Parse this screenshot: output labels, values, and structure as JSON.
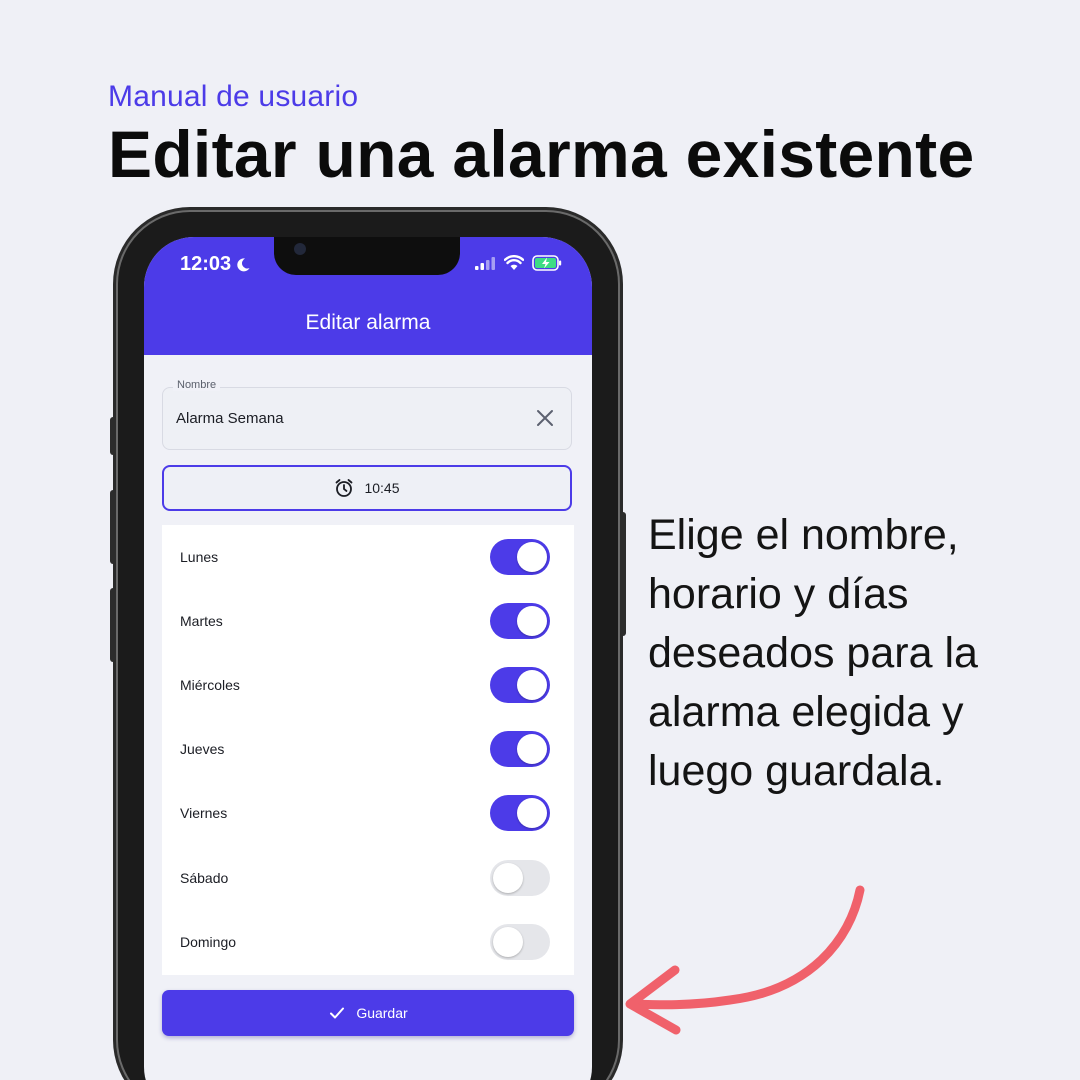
{
  "header": {
    "kicker": "Manual de usuario",
    "title": "Editar una alarma existente"
  },
  "caption": "Elige el nombre, horario y días deseados para la alarma elegida y luego guardala.",
  "phone": {
    "status_bar": {
      "time": "12:03",
      "icons": [
        "moon-icon",
        "signal-icon",
        "wifi-icon",
        "battery-charging-icon"
      ]
    },
    "appbar_title": "Editar alarma",
    "name_field": {
      "label": "Nombre",
      "value": "Alarma Semana",
      "clear_icon": "close-icon"
    },
    "time_button": {
      "icon": "alarm-clock-icon",
      "value": "10:45"
    },
    "days": [
      {
        "label": "Lunes",
        "enabled": true
      },
      {
        "label": "Martes",
        "enabled": true
      },
      {
        "label": "Miércoles",
        "enabled": true
      },
      {
        "label": "Jueves",
        "enabled": true
      },
      {
        "label": "Viernes",
        "enabled": true
      },
      {
        "label": "Sábado",
        "enabled": false
      },
      {
        "label": "Domingo",
        "enabled": false
      }
    ],
    "save_button": {
      "icon": "check-icon",
      "label": "Guardar"
    }
  },
  "colors": {
    "accent": "#4c3be8",
    "background": "#eff0f6",
    "arrow": "#f0616b"
  }
}
